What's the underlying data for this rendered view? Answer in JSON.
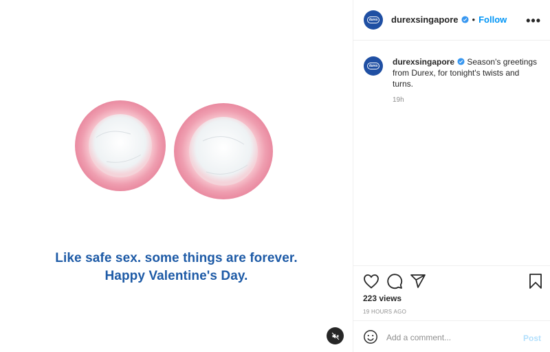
{
  "post": {
    "caption_line1": "Like safe sex. some things are forever.",
    "caption_line2": "Happy Valentine's Day.",
    "mute_icon": "mute-icon"
  },
  "header": {
    "avatar_logo": "durex",
    "username": "durexsingapore",
    "separator": "•",
    "follow_label": "Follow",
    "more_label": "•••"
  },
  "comment": {
    "avatar_logo": "durex",
    "username": "durexsingapore",
    "text": " Season's greetings from Durex, for tonight's twists and turns.",
    "time": "19h"
  },
  "actions": {
    "icons": [
      "heart-icon",
      "comment-icon",
      "share-icon",
      "bookmark-icon"
    ],
    "views": "223 views",
    "posted_ago": "19 HOURS AGO"
  },
  "add_comment": {
    "placeholder": "Add a comment...",
    "post_label": "Post",
    "emoji_icon": "emoji-icon"
  },
  "colors": {
    "follow": "#0095f6",
    "caption_art": "#1d5aa6",
    "avatar": "#1f4fa3",
    "post_disabled": "#b2dffc"
  }
}
